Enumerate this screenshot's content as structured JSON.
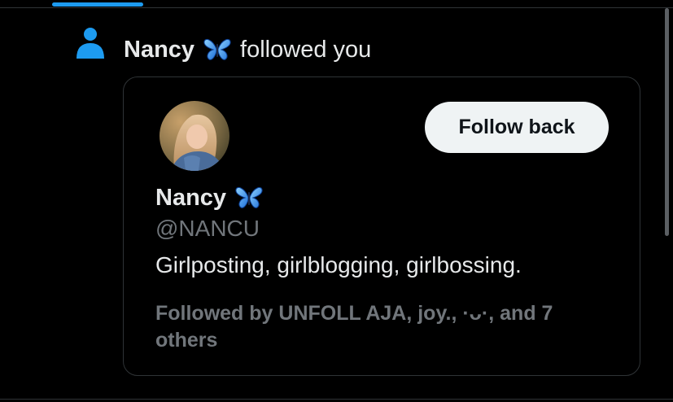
{
  "notification": {
    "icon": "person-icon",
    "actor_name": "Nancy",
    "actor_emoji": "butterfly-icon",
    "action_text": "followed you"
  },
  "profile_card": {
    "avatar": "avatar",
    "display_name": "Nancy",
    "name_emoji": "butterfly-icon",
    "handle": "@NANCU",
    "bio": "Girlposting, girlblogging, girlbossing.",
    "followed_by_text": "Followed by UNFOLL AJA, joy., ·ᴗ·, and 7 others",
    "follow_button_label": "Follow back"
  },
  "colors": {
    "background": "#000000",
    "accent": "#1d9bf0",
    "primary_text": "#e7e9ea",
    "secondary_text": "#71767b",
    "border": "#2f3336",
    "button_bg": "#eff3f4",
    "button_text": "#0f1419"
  }
}
